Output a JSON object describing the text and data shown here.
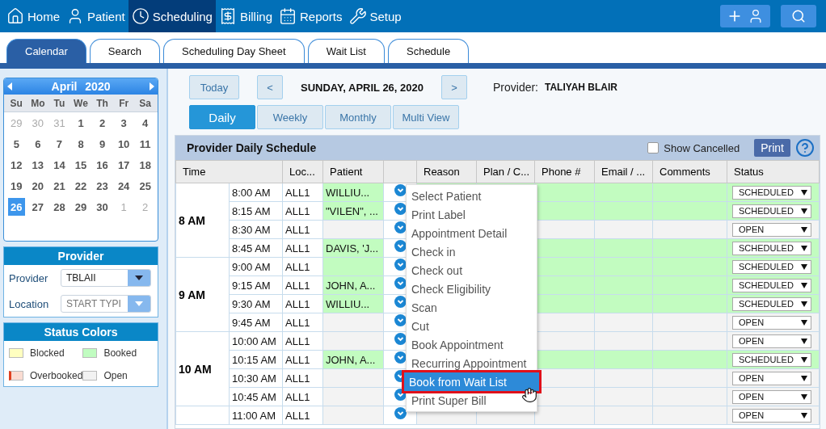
{
  "nav": {
    "items": [
      {
        "label": "Home",
        "selected": false
      },
      {
        "label": "Patient",
        "selected": false
      },
      {
        "label": "Scheduling",
        "selected": true
      },
      {
        "label": "Billing",
        "selected": false
      },
      {
        "label": "Reports",
        "selected": false
      },
      {
        "label": "Setup",
        "selected": false
      }
    ]
  },
  "tabs": [
    {
      "label": "Calendar",
      "selected": true
    },
    {
      "label": "Search",
      "selected": false
    },
    {
      "label": "Scheduling Day Sheet",
      "selected": false
    },
    {
      "label": "Wait List",
      "selected": false
    },
    {
      "label": "Schedule",
      "selected": false
    }
  ],
  "calendar": {
    "month": "April",
    "year": "2020",
    "weekdays": [
      "Su",
      "Mo",
      "Tu",
      "We",
      "Th",
      "Fr",
      "Sa"
    ],
    "days": [
      {
        "label": "29",
        "other_month": true,
        "selected": false
      },
      {
        "label": "30",
        "other_month": true,
        "selected": false
      },
      {
        "label": "31",
        "other_month": true,
        "selected": false
      },
      {
        "label": "1",
        "other_month": false,
        "selected": false
      },
      {
        "label": "2",
        "other_month": false,
        "selected": false
      },
      {
        "label": "3",
        "other_month": false,
        "selected": false
      },
      {
        "label": "4",
        "other_month": false,
        "selected": false
      },
      {
        "label": "5",
        "other_month": false,
        "selected": false
      },
      {
        "label": "6",
        "other_month": false,
        "selected": false
      },
      {
        "label": "7",
        "other_month": false,
        "selected": false
      },
      {
        "label": "8",
        "other_month": false,
        "selected": false
      },
      {
        "label": "9",
        "other_month": false,
        "selected": false
      },
      {
        "label": "10",
        "other_month": false,
        "selected": false
      },
      {
        "label": "11",
        "other_month": false,
        "selected": false
      },
      {
        "label": "12",
        "other_month": false,
        "selected": false
      },
      {
        "label": "13",
        "other_month": false,
        "selected": false
      },
      {
        "label": "14",
        "other_month": false,
        "selected": false
      },
      {
        "label": "15",
        "other_month": false,
        "selected": false
      },
      {
        "label": "16",
        "other_month": false,
        "selected": false
      },
      {
        "label": "17",
        "other_month": false,
        "selected": false
      },
      {
        "label": "18",
        "other_month": false,
        "selected": false
      },
      {
        "label": "19",
        "other_month": false,
        "selected": false
      },
      {
        "label": "20",
        "other_month": false,
        "selected": false
      },
      {
        "label": "21",
        "other_month": false,
        "selected": false
      },
      {
        "label": "22",
        "other_month": false,
        "selected": false
      },
      {
        "label": "23",
        "other_month": false,
        "selected": false
      },
      {
        "label": "24",
        "other_month": false,
        "selected": false
      },
      {
        "label": "25",
        "other_month": false,
        "selected": false
      },
      {
        "label": "26",
        "other_month": false,
        "selected": true
      },
      {
        "label": "27",
        "other_month": false,
        "selected": false
      },
      {
        "label": "28",
        "other_month": false,
        "selected": false
      },
      {
        "label": "29",
        "other_month": false,
        "selected": false
      },
      {
        "label": "30",
        "other_month": false,
        "selected": false
      },
      {
        "label": "1",
        "other_month": true,
        "selected": false
      },
      {
        "label": "2",
        "other_month": true,
        "selected": false
      }
    ]
  },
  "provider_panel": {
    "title": "Provider",
    "fields": [
      {
        "label": "Provider",
        "value": "TBLAII"
      },
      {
        "label": "Location",
        "placeholder": "START TYPI"
      }
    ]
  },
  "status_colors": {
    "title": "Status Colors",
    "items": [
      {
        "label": "Blocked",
        "color": "#ffffc0"
      },
      {
        "label": "Booked",
        "color": "#c0fcc0"
      },
      {
        "label": "Overbooked",
        "color": "#fadcd2"
      },
      {
        "label": "Open",
        "color": "#f2f2f2"
      }
    ]
  },
  "toolbar": {
    "today": "Today",
    "prev": "<",
    "date": "SUNDAY, APRIL 26, 2020",
    "next": ">",
    "provider_label": "Provider:",
    "provider_name": "TALIYAH BLAIR"
  },
  "views": [
    {
      "label": "Daily",
      "selected": true
    },
    {
      "label": "Weekly",
      "selected": false
    },
    {
      "label": "Monthly",
      "selected": false
    },
    {
      "label": "Multi View",
      "selected": false
    }
  ],
  "schedule": {
    "title": "Provider Daily Schedule",
    "show_cancelled": {
      "label": "Show Cancelled",
      "checked": false
    },
    "print": "Print",
    "columns": [
      {
        "label": "Time",
        "kind": "time"
      },
      {
        "label": "Loc...",
        "kind": "text"
      },
      {
        "label": "Patient",
        "kind": "patient"
      },
      {
        "label": "Reason",
        "kind": "text"
      },
      {
        "label": "Plan / C...",
        "kind": "text"
      },
      {
        "label": "Phone #",
        "kind": "text"
      },
      {
        "label": "Email / ...",
        "kind": "text"
      },
      {
        "label": "Comments",
        "kind": "text"
      },
      {
        "label": "Status",
        "kind": "text"
      }
    ],
    "groups": [
      {
        "hour": "8 AM",
        "slots": [
          {
            "time": "8:00 AM",
            "location": "ALL1",
            "patient": "WILLIU...",
            "kind": "booked",
            "status": "SCHEDULED"
          },
          {
            "time": "8:15 AM",
            "location": "ALL1",
            "patient": "\"VILEN\", ...",
            "kind": "booked",
            "status": "SCHEDULED"
          },
          {
            "time": "8:30 AM",
            "location": "ALL1",
            "kind": "open",
            "status": "OPEN"
          },
          {
            "time": "8:45 AM",
            "location": "ALL1",
            "patient": "DAVIS, 'J...",
            "kind": "booked",
            "status": "SCHEDULED"
          }
        ]
      },
      {
        "hour": "9 AM",
        "slots": [
          {
            "time": "9:00 AM",
            "location": "ALL1",
            "kind": "booked",
            "status": "SCHEDULED"
          },
          {
            "time": "9:15 AM",
            "location": "ALL1",
            "patient": "JOHN, A...",
            "kind": "booked",
            "status": "SCHEDULED"
          },
          {
            "time": "9:30 AM",
            "location": "ALL1",
            "patient": "WILLIU...",
            "kind": "booked",
            "status": "SCHEDULED"
          },
          {
            "time": "9:45 AM",
            "location": "ALL1",
            "kind": "open",
            "status": "OPEN"
          }
        ]
      },
      {
        "hour": "10 AM",
        "slots": [
          {
            "time": "10:00 AM",
            "location": "ALL1",
            "kind": "open",
            "status": "OPEN"
          },
          {
            "time": "10:15 AM",
            "location": "ALL1",
            "patient": "JOHN, A...",
            "kind": "booked",
            "status": "SCHEDULED"
          },
          {
            "time": "10:30 AM",
            "location": "ALL1",
            "kind": "open",
            "status": "OPEN"
          },
          {
            "time": "10:45 AM",
            "location": "ALL1",
            "kind": "open",
            "status": "OPEN"
          }
        ]
      },
      {
        "slots": [
          {
            "time": "11:00 AM",
            "location": "ALL1",
            "kind": "open",
            "status": "OPEN"
          }
        ]
      }
    ]
  },
  "context_menu": {
    "items": [
      {
        "label": "Select Patient",
        "selected": false
      },
      {
        "label": "Print Label",
        "selected": false
      },
      {
        "label": "Appointment Detail",
        "selected": false
      },
      {
        "label": "Check in",
        "selected": false
      },
      {
        "label": "Check out",
        "selected": false
      },
      {
        "label": "Check Eligibility",
        "selected": false
      },
      {
        "label": "Scan",
        "selected": false
      },
      {
        "label": "Cut",
        "selected": false
      },
      {
        "label": "Book Appointment",
        "selected": false
      },
      {
        "label": "Recurring Appointment",
        "selected": false
      },
      {
        "label": "Book from Wait List",
        "selected": true
      },
      {
        "label": "Print Super Bill",
        "selected": false
      }
    ]
  }
}
